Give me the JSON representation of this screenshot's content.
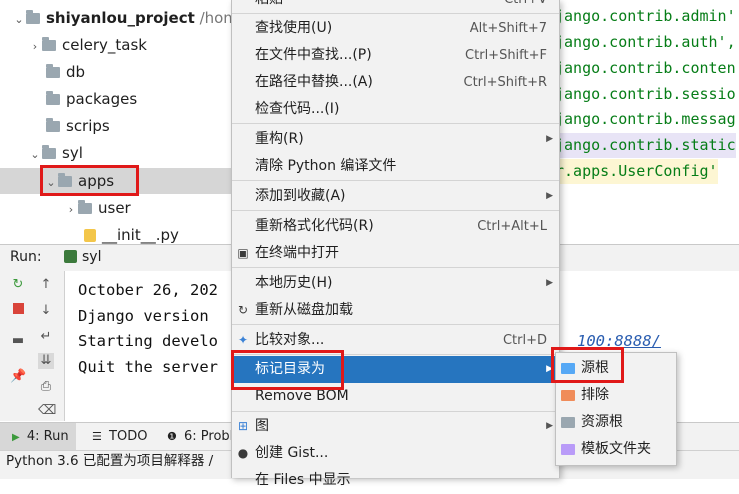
{
  "colors": {
    "menu_highlight": "#2675bf",
    "annotation_red": "#e01919",
    "source_root": "#56a8f5",
    "excluded": "#f08c5a",
    "resource_root": "#9aa7b0",
    "template_folder": "#b99bf8"
  },
  "tree": {
    "project_name": "shiyanlou_project",
    "project_path": "/hom",
    "items": [
      {
        "label": "celery_task",
        "arrow": "›"
      },
      {
        "label": "db",
        "arrow": ""
      },
      {
        "label": "packages",
        "arrow": ""
      },
      {
        "label": "scrips",
        "arrow": ""
      },
      {
        "label": "syl",
        "arrow": "⌄"
      },
      {
        "label": "apps",
        "arrow": "⌄"
      },
      {
        "label": "user",
        "arrow": "›"
      },
      {
        "label": "__init__.py",
        "arrow": ""
      }
    ]
  },
  "code": {
    "lines": [
      "jango.contrib.admin'",
      "jango.contrib.auth',",
      "jango.contrib.conten",
      "jango.contrib.sessio",
      "jango.contrib.messag",
      "jango.contrib.static",
      "r.apps.UserConfig'"
    ]
  },
  "run": {
    "label": "Run:",
    "tab": "syl"
  },
  "console": {
    "lines": [
      "October 26, 202",
      "Django version",
      "Starting develo",
      "Quit the server"
    ],
    "link_fragment": "100:8888/"
  },
  "bottom_tabs": {
    "run": "4: Run",
    "todo": "TODO",
    "problems": "6: Probl"
  },
  "status": {
    "text": "Python 3.6 已配置为项目解释器 /"
  },
  "menu": {
    "top_fragment": "粘贴",
    "top_shortcut": "Ctrl+V",
    "items": [
      {
        "label": "查找使用(U)",
        "shortcut": "Alt+Shift+7"
      },
      {
        "label": "在文件中查找...(P)",
        "shortcut": "Ctrl+Shift+F"
      },
      {
        "label": "在路径中替换...(A)",
        "shortcut": "Ctrl+Shift+R"
      },
      {
        "label": "检查代码...(I)",
        "shortcut": ""
      },
      {
        "label": "重构(R)",
        "shortcut": ""
      },
      {
        "label": "清除 Python 编译文件",
        "shortcut": ""
      },
      {
        "label": "添加到收藏(A)",
        "shortcut": ""
      },
      {
        "label": "重新格式化代码(R)",
        "shortcut": "Ctrl+Alt+L"
      },
      {
        "label": "在终端中打开",
        "shortcut": ""
      },
      {
        "label": "本地历史(H)",
        "shortcut": ""
      },
      {
        "label": "重新从磁盘加载",
        "shortcut": ""
      },
      {
        "label": "比较对象...",
        "shortcut": "Ctrl+D"
      },
      {
        "label": "标记目录为",
        "shortcut": ""
      },
      {
        "label": "Remove BOM",
        "shortcut": ""
      },
      {
        "label": "图",
        "shortcut": ""
      },
      {
        "label": "创建 Gist...",
        "shortcut": ""
      },
      {
        "label": "在 Files 中显示",
        "shortcut": ""
      }
    ]
  },
  "submenu": {
    "items": [
      {
        "label": "源根",
        "icon": "source-root-folder-icon"
      },
      {
        "label": "排除",
        "icon": "excluded-folder-icon"
      },
      {
        "label": "资源根",
        "icon": "resource-root-folder-icon"
      },
      {
        "label": "模板文件夹",
        "icon": "template-folder-icon"
      }
    ]
  }
}
